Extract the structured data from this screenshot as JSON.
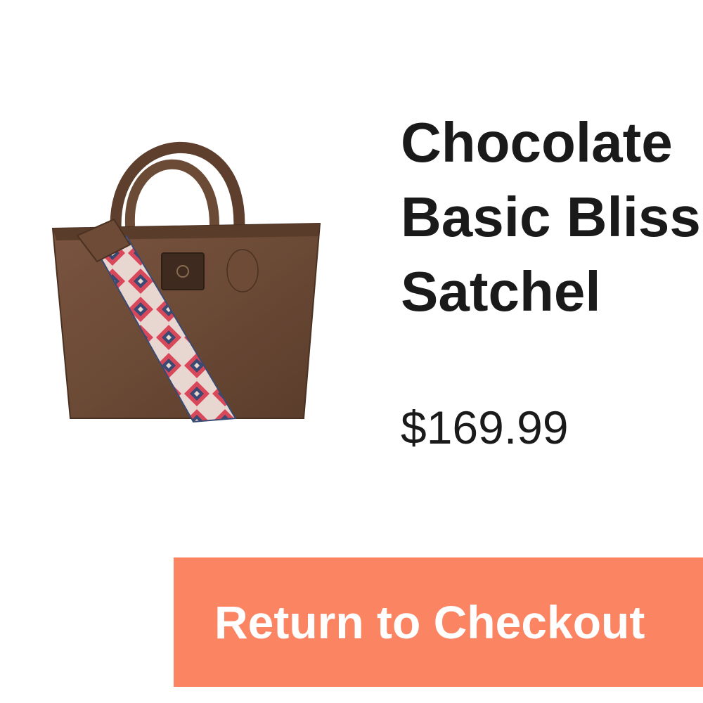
{
  "product": {
    "image_alt": "Chocolate Basic Bliss Satchel product photo",
    "title_lines": [
      "Chocolate",
      "Basic Bliss",
      "Satchel"
    ],
    "price": "$169.99"
  },
  "actions": {
    "return_label": "Return to Checkout"
  },
  "colors": {
    "button": "#fb8463",
    "text": "#1a1a1a",
    "leather": "#6b4a36"
  }
}
